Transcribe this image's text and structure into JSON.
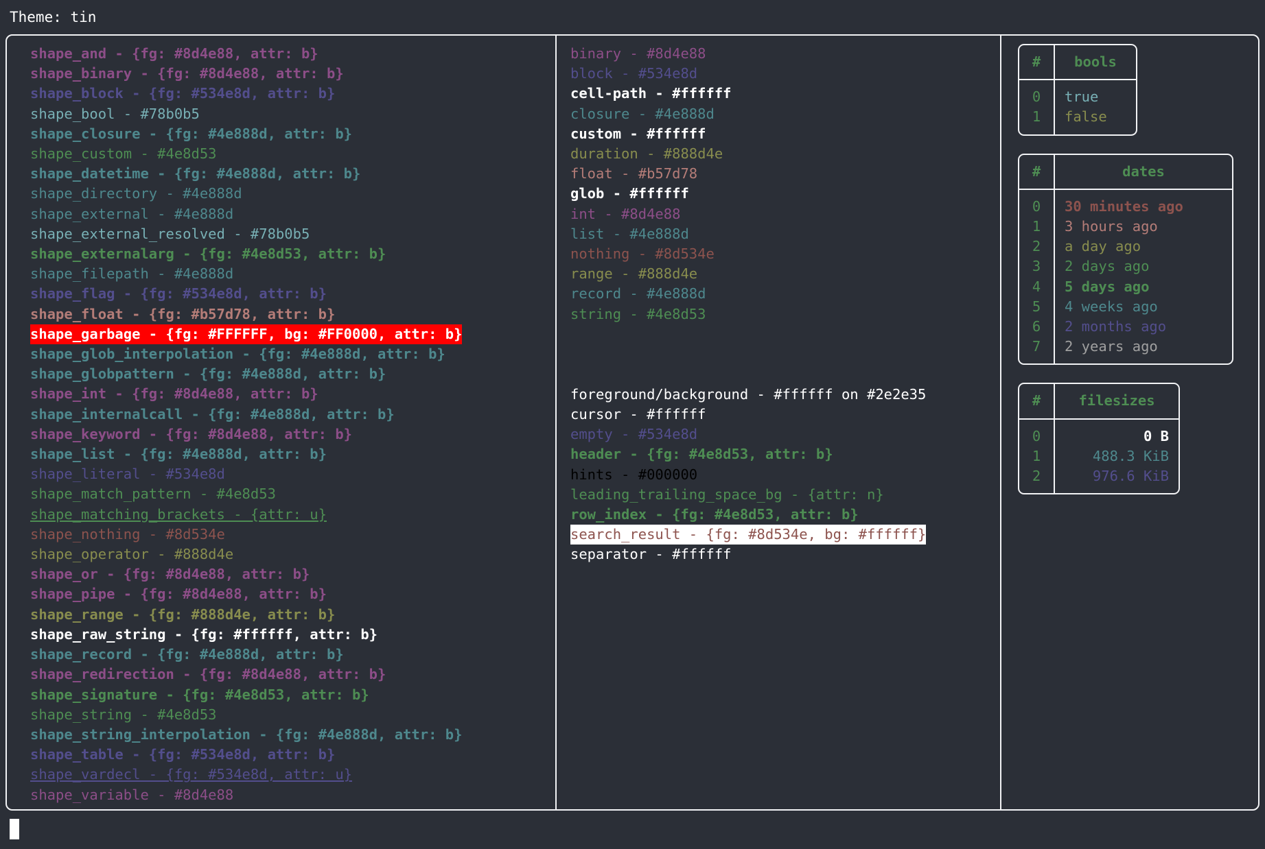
{
  "header": {
    "theme_label": "Theme: tin"
  },
  "colors": {
    "background": "#2b2f37",
    "border": "#f2f3f5",
    "white": "#ffffff",
    "magenta": "#8d4e88",
    "purple": "#534e8d",
    "blue": "#78b0b5",
    "teal": "#4e888d",
    "green": "#4e8d53",
    "olive": "#888d4e",
    "salmon": "#b57d78",
    "brown": "#8d534e",
    "garbage_fg": "#FFFFFF",
    "garbage_bg": "#FF0000",
    "search_result_fg": "#8d534e",
    "search_result_bg": "#ffffff",
    "hints": "#000000",
    "gray": "#a0a0a0"
  },
  "shapes_column": [
    {
      "text": "shape_and - {fg: #8d4e88, attr: b}",
      "fg": "#8d4e88",
      "bold": true,
      "underline": false
    },
    {
      "text": "shape_binary - {fg: #8d4e88, attr: b}",
      "fg": "#8d4e88",
      "bold": true,
      "underline": false
    },
    {
      "text": "shape_block - {fg: #534e8d, attr: b}",
      "fg": "#534e8d",
      "bold": true,
      "underline": false
    },
    {
      "text": "shape_bool - #78b0b5",
      "fg": "#78b0b5",
      "bold": false,
      "underline": false
    },
    {
      "text": "shape_closure - {fg: #4e888d, attr: b}",
      "fg": "#4e888d",
      "bold": true,
      "underline": false
    },
    {
      "text": "shape_custom - #4e8d53",
      "fg": "#4e8d53",
      "bold": false,
      "underline": false
    },
    {
      "text": "shape_datetime - {fg: #4e888d, attr: b}",
      "fg": "#4e888d",
      "bold": true,
      "underline": false
    },
    {
      "text": "shape_directory - #4e888d",
      "fg": "#4e888d",
      "bold": false,
      "underline": false
    },
    {
      "text": "shape_external - #4e888d",
      "fg": "#4e888d",
      "bold": false,
      "underline": false
    },
    {
      "text": "shape_external_resolved - #78b0b5",
      "fg": "#78b0b5",
      "bold": false,
      "underline": false
    },
    {
      "text": "shape_externalarg - {fg: #4e8d53, attr: b}",
      "fg": "#4e8d53",
      "bold": true,
      "underline": false
    },
    {
      "text": "shape_filepath - #4e888d",
      "fg": "#4e888d",
      "bold": false,
      "underline": false
    },
    {
      "text": "shape_flag - {fg: #534e8d, attr: b}",
      "fg": "#534e8d",
      "bold": true,
      "underline": false
    },
    {
      "text": "shape_float - {fg: #b57d78, attr: b}",
      "fg": "#b57d78",
      "bold": true,
      "underline": false
    },
    {
      "text": "shape_garbage - {fg: #FFFFFF, bg: #FF0000, attr: b}",
      "fg": "#FFFFFF",
      "bg": "#FF0000",
      "bold": true,
      "underline": false
    },
    {
      "text": "shape_glob_interpolation - {fg: #4e888d, attr: b}",
      "fg": "#4e888d",
      "bold": true,
      "underline": false
    },
    {
      "text": "shape_globpattern - {fg: #4e888d, attr: b}",
      "fg": "#4e888d",
      "bold": true,
      "underline": false
    },
    {
      "text": "shape_int - {fg: #8d4e88, attr: b}",
      "fg": "#8d4e88",
      "bold": true,
      "underline": false
    },
    {
      "text": "shape_internalcall - {fg: #4e888d, attr: b}",
      "fg": "#4e888d",
      "bold": true,
      "underline": false
    },
    {
      "text": "shape_keyword - {fg: #8d4e88, attr: b}",
      "fg": "#8d4e88",
      "bold": true,
      "underline": false
    },
    {
      "text": "shape_list - {fg: #4e888d, attr: b}",
      "fg": "#4e888d",
      "bold": true,
      "underline": false
    },
    {
      "text": "shape_literal - #534e8d",
      "fg": "#534e8d",
      "bold": false,
      "underline": false
    },
    {
      "text": "shape_match_pattern - #4e8d53",
      "fg": "#4e8d53",
      "bold": false,
      "underline": false
    },
    {
      "text": "shape_matching_brackets - {attr: u}",
      "fg": "#4e8d53",
      "bold": false,
      "underline": true
    },
    {
      "text": "shape_nothing - #8d534e",
      "fg": "#8d534e",
      "bold": false,
      "underline": false
    },
    {
      "text": "shape_operator - #888d4e",
      "fg": "#888d4e",
      "bold": false,
      "underline": false
    },
    {
      "text": "shape_or - {fg: #8d4e88, attr: b}",
      "fg": "#8d4e88",
      "bold": true,
      "underline": false
    },
    {
      "text": "shape_pipe - {fg: #8d4e88, attr: b}",
      "fg": "#8d4e88",
      "bold": true,
      "underline": false
    },
    {
      "text": "shape_range - {fg: #888d4e, attr: b}",
      "fg": "#888d4e",
      "bold": true,
      "underline": false
    },
    {
      "text": "shape_raw_string - {fg: #ffffff, attr: b}",
      "fg": "#ffffff",
      "bold": true,
      "underline": false
    },
    {
      "text": "shape_record - {fg: #4e888d, attr: b}",
      "fg": "#4e888d",
      "bold": true,
      "underline": false
    },
    {
      "text": "shape_redirection - {fg: #8d4e88, attr: b}",
      "fg": "#8d4e88",
      "bold": true,
      "underline": false
    },
    {
      "text": "shape_signature - {fg: #4e8d53, attr: b}",
      "fg": "#4e8d53",
      "bold": true,
      "underline": false
    },
    {
      "text": "shape_string - #4e8d53",
      "fg": "#4e8d53",
      "bold": false,
      "underline": false
    },
    {
      "text": "shape_string_interpolation - {fg: #4e888d, attr: b}",
      "fg": "#4e888d",
      "bold": true,
      "underline": false
    },
    {
      "text": "shape_table - {fg: #534e8d, attr: b}",
      "fg": "#534e8d",
      "bold": true,
      "underline": false
    },
    {
      "text": "shape_vardecl - {fg: #534e8d, attr: u}",
      "fg": "#534e8d",
      "bold": false,
      "underline": true
    },
    {
      "text": "shape_variable - #8d4e88",
      "fg": "#8d4e88",
      "bold": false,
      "underline": false
    }
  ],
  "types_column": [
    {
      "text": "binary - #8d4e88",
      "fg": "#8d4e88",
      "bold": false,
      "underline": false
    },
    {
      "text": "block - #534e8d",
      "fg": "#534e8d",
      "bold": false,
      "underline": false
    },
    {
      "text": "cell-path - #ffffff",
      "fg": "#ffffff",
      "bold": true,
      "underline": false
    },
    {
      "text": "closure - #4e888d",
      "fg": "#4e888d",
      "bold": false,
      "underline": false
    },
    {
      "text": "custom - #ffffff",
      "fg": "#ffffff",
      "bold": true,
      "underline": false
    },
    {
      "text": "duration - #888d4e",
      "fg": "#888d4e",
      "bold": false,
      "underline": false
    },
    {
      "text": "float - #b57d78",
      "fg": "#b57d78",
      "bold": false,
      "underline": false
    },
    {
      "text": "glob - #ffffff",
      "fg": "#ffffff",
      "bold": true,
      "underline": false
    },
    {
      "text": "int - #8d4e88",
      "fg": "#8d4e88",
      "bold": false,
      "underline": false
    },
    {
      "text": "list - #4e888d",
      "fg": "#4e888d",
      "bold": false,
      "underline": false
    },
    {
      "text": "nothing - #8d534e",
      "fg": "#8d534e",
      "bold": false,
      "underline": false
    },
    {
      "text": "range - #888d4e",
      "fg": "#888d4e",
      "bold": false,
      "underline": false
    },
    {
      "text": "record - #4e888d",
      "fg": "#4e888d",
      "bold": false,
      "underline": false
    },
    {
      "text": "string - #4e8d53",
      "fg": "#4e8d53",
      "bold": false,
      "underline": false
    }
  ],
  "ui_column": [
    {
      "text": "foreground/background - #ffffff on #2e2e35",
      "fg": "#ffffff",
      "bold": false,
      "underline": false
    },
    {
      "text": "cursor - #ffffff",
      "fg": "#ffffff",
      "bold": false,
      "underline": false
    },
    {
      "text": "empty - #534e8d",
      "fg": "#534e8d",
      "bold": false,
      "underline": false
    },
    {
      "text": "header - {fg: #4e8d53, attr: b}",
      "fg": "#4e8d53",
      "bold": true,
      "underline": false
    },
    {
      "text": "hints - #000000",
      "fg": "#000000",
      "bold": false,
      "underline": false
    },
    {
      "text": "leading_trailing_space_bg - {attr: n}",
      "fg": "#4e8d53",
      "bold": false,
      "underline": false
    },
    {
      "text": "row_index - {fg: #4e8d53, attr: b}",
      "fg": "#4e8d53",
      "bold": true,
      "underline": false
    },
    {
      "text": "search_result - {fg: #8d534e, bg: #ffffff}",
      "fg": "#8d534e",
      "bg": "#ffffff",
      "bold": false,
      "underline": false
    },
    {
      "text": "separator - #ffffff",
      "fg": "#ffffff",
      "bold": false,
      "underline": false
    }
  ],
  "tables": {
    "bools": {
      "index_header": "#",
      "value_header": "bools",
      "rows": [
        {
          "index": "0",
          "value": "true",
          "fg": "#78b0b5"
        },
        {
          "index": "1",
          "value": "false",
          "fg": "#888d4e"
        }
      ]
    },
    "dates": {
      "index_header": "#",
      "value_header": "dates",
      "rows": [
        {
          "index": "0",
          "value": "30 minutes ago",
          "fg": "#8d534e",
          "bold": true
        },
        {
          "index": "1",
          "value": "3 hours ago",
          "fg": "#b57d78",
          "bold": false
        },
        {
          "index": "2",
          "value": "a day ago",
          "fg": "#888d4e",
          "bold": false
        },
        {
          "index": "3",
          "value": "2 days ago",
          "fg": "#4e8d53",
          "bold": false
        },
        {
          "index": "4",
          "value": "5 days ago",
          "fg": "#4e8d53",
          "bold": true
        },
        {
          "index": "5",
          "value": "4 weeks ago",
          "fg": "#4e888d",
          "bold": false
        },
        {
          "index": "6",
          "value": "2 months ago",
          "fg": "#534e8d",
          "bold": false
        },
        {
          "index": "7",
          "value": "2 years ago",
          "fg": "#a0a0a0",
          "bold": false
        }
      ]
    },
    "filesizes": {
      "index_header": "#",
      "value_header": "filesizes",
      "rows": [
        {
          "index": "0",
          "value": "0 B",
          "fg": "#ffffff",
          "bold": true
        },
        {
          "index": "1",
          "value": "488.3 KiB",
          "fg": "#4e888d",
          "bold": false
        },
        {
          "index": "2",
          "value": "976.6 KiB",
          "fg": "#534e8d",
          "bold": false
        }
      ]
    }
  }
}
